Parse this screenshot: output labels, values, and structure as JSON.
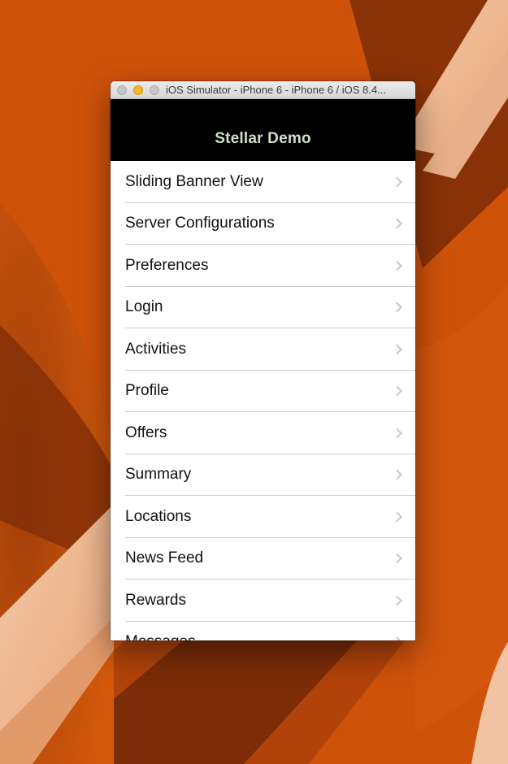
{
  "window": {
    "title": "iOS Simulator - iPhone 6 - iPhone 6 / iOS 8.4..."
  },
  "navbar": {
    "title": "Stellar Demo"
  },
  "menu": {
    "items": [
      {
        "label": "Sliding Banner View"
      },
      {
        "label": "Server Configurations"
      },
      {
        "label": "Preferences"
      },
      {
        "label": "Login"
      },
      {
        "label": "Activities"
      },
      {
        "label": "Profile"
      },
      {
        "label": "Offers"
      },
      {
        "label": "Summary"
      },
      {
        "label": "Locations"
      },
      {
        "label": "News Feed"
      },
      {
        "label": "Rewards"
      },
      {
        "label": "Messages"
      }
    ]
  },
  "colors": {
    "wallpaper_base": "#c94c0a",
    "navbar_bg": "#000000",
    "navbar_title": "#cfe0c8",
    "minimize_button": "#f5b62a"
  }
}
